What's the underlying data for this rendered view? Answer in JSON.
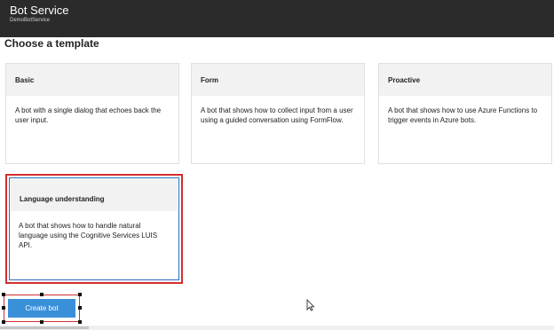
{
  "app": {
    "title": "Bot Service",
    "subtitle": "DemoBotService"
  },
  "page": {
    "heading": "Choose a template"
  },
  "templates": [
    {
      "name": "Basic",
      "description": "A bot with a single dialog that echoes back the user input."
    },
    {
      "name": "Form",
      "description": "A bot that shows how to collect input from a user using a guided conversation using FormFlow."
    },
    {
      "name": "Proactive",
      "description": "A bot that shows how to use Azure Functions to trigger events in Azure bots."
    },
    {
      "name": "Language understanding",
      "description": "A bot that shows how to handle natural language using the Cognitive Services LUIS API.",
      "selected": true
    }
  ],
  "actions": {
    "create_label": "Create bot"
  },
  "colors": {
    "topbar": "#2b2b2b",
    "button": "#3a8fd9",
    "highlight": "#d32f2f",
    "selected_border": "#2a6ebd"
  },
  "icons": {
    "cursor": "mouse-pointer-icon"
  }
}
